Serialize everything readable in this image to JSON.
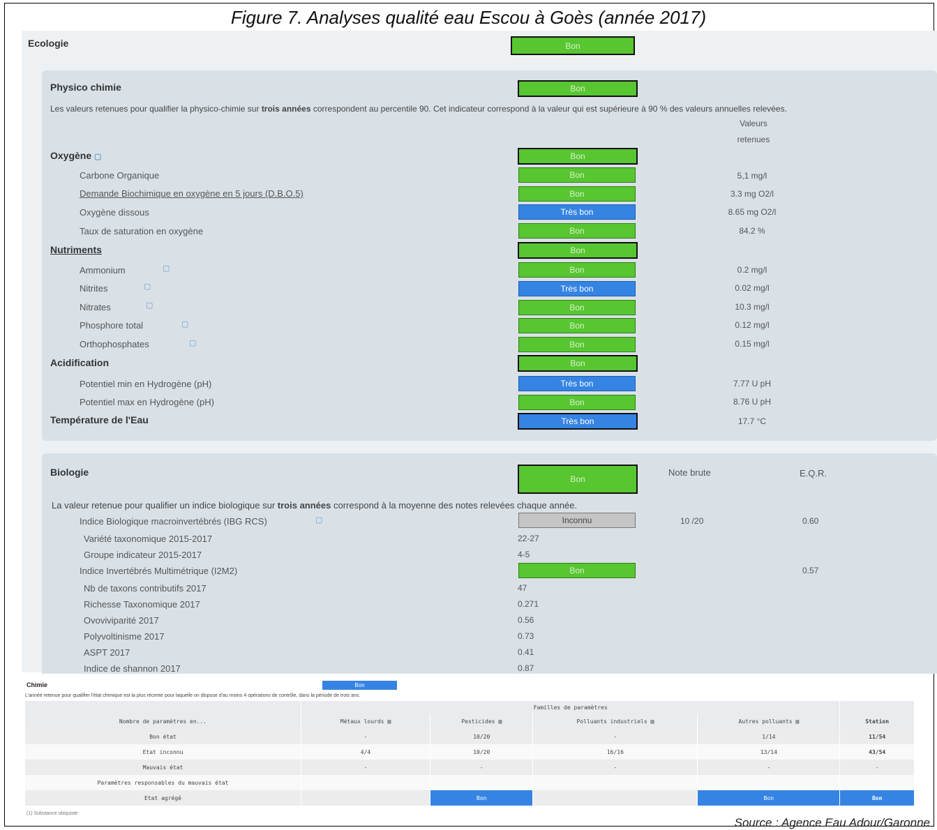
{
  "figure_title": "Figure 7. Analyses qualité eau Escou à Goès (année 2017)",
  "source": "Source : Agence Eau Adour/Garonne",
  "ecologie": {
    "label": "Ecologie",
    "status": "Bon"
  },
  "physico": {
    "title": "Physico chimie",
    "status": "Bon",
    "note_pre": "Les valeurs retenues pour qualifier la physico-chimie sur ",
    "note_bold": "trois années",
    "note_post": " correspondent au percentile 90. Cet indicateur correspond à la valeur qui est supérieure à 90 % des valeurs annuelles relevées.",
    "values_header_1": "Valeurs",
    "values_header_2": "retenues",
    "oxygene": {
      "label": "Oxygène",
      "status": "Bon",
      "rows": [
        {
          "label": "Carbone Organique",
          "status": "Bon",
          "value": "5,1 mg/l"
        },
        {
          "label": "Demande Biochimique en oxygène en 5 jours (D.B.O.5)",
          "status": "Bon",
          "value": "3.3 mg O2/l"
        },
        {
          "label": "Oxygène dissous",
          "status": "Très bon",
          "value": "8.65 mg O2/l"
        },
        {
          "label": "Taux de saturation en oxygène",
          "status": "Bon",
          "value": "84.2 %"
        }
      ]
    },
    "nutriments": {
      "label": "Nutriments",
      "status": "Bon",
      "rows": [
        {
          "label": "Ammonium",
          "status": "Bon",
          "value": "0.2 mg/l"
        },
        {
          "label": "Nitrites",
          "status": "Très bon",
          "value": "0.02 mg/l"
        },
        {
          "label": "Nitrates",
          "status": "Bon",
          "value": "10.3 mg/l"
        },
        {
          "label": "Phosphore total",
          "status": "Bon",
          "value": "0.12 mg/l"
        },
        {
          "label": "Orthophosphates",
          "status": "Bon",
          "value": "0.15 mg/l"
        }
      ]
    },
    "acidification": {
      "label": "Acidification",
      "status": "Bon",
      "rows": [
        {
          "label": "Potentiel min en Hydrogène (pH)",
          "status": "Très bon",
          "value": "7.77 U pH"
        },
        {
          "label": "Potentiel max en Hydrogène (pH)",
          "status": "Bon",
          "value": "8.76 U pH"
        }
      ]
    },
    "temperature": {
      "label": "Température de l'Eau",
      "status": "Très bon",
      "value": "17.7 °C"
    }
  },
  "biologie": {
    "title": "Biologie",
    "status": "Bon",
    "col_note_brute": "Note brute",
    "col_eqr": "E.Q.R.",
    "note_pre": "La valeur retenue pour qualifier un indice biologique sur ",
    "note_bold": "trois années",
    "note_post": " correspond à la moyenne des notes relevées chaque année.",
    "ibg": {
      "label": "Indice Biologique macroinvertébrés (IBG RCS)",
      "status": "Inconnu",
      "note": "10 /20",
      "eqr": "0.60"
    },
    "ibg_sub": [
      {
        "label": "Variété taxonomique 2015-2017",
        "value": "22-27"
      },
      {
        "label": "Groupe indicateur 2015-2017",
        "value": "4-5"
      }
    ],
    "i2m2": {
      "label": "Indice Invertébrés Multimétrique (I2M2)",
      "status": "Bon",
      "eqr": "0.57"
    },
    "i2m2_sub": [
      {
        "label": "Nb de taxons contributifs 2017",
        "value": "47"
      },
      {
        "label": "Richesse Taxonomique 2017",
        "value": "0.271"
      },
      {
        "label": "Ovoviviparité 2017",
        "value": "0.56"
      },
      {
        "label": "Polyvoltinisme 2017",
        "value": "0.73"
      },
      {
        "label": "ASPT 2017",
        "value": "0.41"
      },
      {
        "label": "Indice de shannon 2017",
        "value": "0.87"
      }
    ]
  },
  "chimie": {
    "label": "Chimie",
    "status": "Bon",
    "note": "L'année retenue pour qualifier l'état chimique est la plus récente pour laquelle on dispose d'au moins 4 opérations de contrôle, dans la période de trois ans.",
    "families_header": "Familles de paramètres",
    "columns": [
      "Nombre de paramètres en...",
      "Métaux lourds",
      "Pesticides",
      "Polluants industriels",
      "Autres polluants",
      "Station"
    ],
    "rows": [
      [
        "Bon état",
        "-",
        "10/20",
        "-",
        "1/14",
        "11/54"
      ],
      [
        "Etat inconnu",
        "4/4",
        "10/20",
        "16/16",
        "13/14",
        "43/54"
      ],
      [
        "Mauvais état",
        "-",
        "-",
        "-",
        "-",
        "-"
      ],
      [
        "Paramètres responsables du mauvais état",
        "",
        "",
        "",
        "",
        ""
      ],
      [
        "Etat agrégé",
        "",
        "Bon",
        "",
        "Bon",
        "Bon"
      ]
    ],
    "footnote": "(1) Substance ubiquiste"
  },
  "colors": {
    "bon": "#58c631",
    "tres_bon": "#3584e4",
    "inconnu": "#c5c5c5"
  },
  "icons": {
    "doc": "pdf-doc-icon",
    "chart": "bar-chart-icon"
  }
}
